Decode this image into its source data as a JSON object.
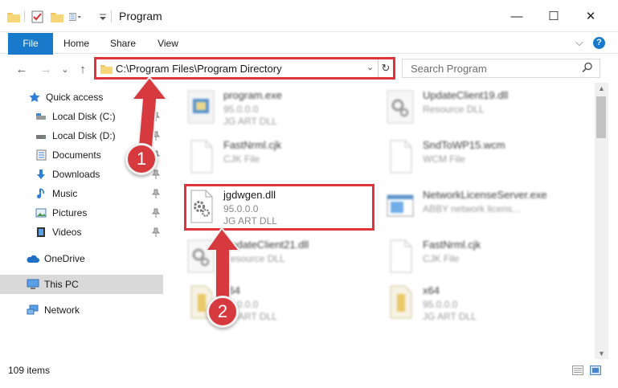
{
  "window": {
    "title": "Program",
    "minimize_label": "—",
    "maximize_label": "☐",
    "close_label": "✕"
  },
  "ribbon": {
    "tabs": [
      {
        "label": "File"
      },
      {
        "label": "Home"
      },
      {
        "label": "Share"
      },
      {
        "label": "View"
      }
    ],
    "collapse_label": "⌵",
    "help_label": "?"
  },
  "address": {
    "path": "C:\\Program Files\\Program Directory",
    "dropdown_label": "⌄",
    "refresh_label": "↻"
  },
  "search": {
    "placeholder": "Search Program"
  },
  "nav": {
    "back_label": "←",
    "forward_label": "→",
    "recent_label": "⌄",
    "up_label": "↑",
    "items": [
      {
        "label": "Quick access",
        "icon": "star-icon",
        "pinned": false
      },
      {
        "label": "Local Disk (C:)",
        "icon": "drive-icon",
        "pinned": true
      },
      {
        "label": "Local Disk (D:)",
        "icon": "drive-icon",
        "pinned": true
      },
      {
        "label": "Documents",
        "icon": "documents-icon",
        "pinned": true
      },
      {
        "label": "Downloads",
        "icon": "download-icon",
        "pinned": true
      },
      {
        "label": "Music",
        "icon": "music-icon",
        "pinned": true
      },
      {
        "label": "Pictures",
        "icon": "pictures-icon",
        "pinned": true
      },
      {
        "label": "Videos",
        "icon": "videos-icon",
        "pinned": true
      },
      {
        "label": "OneDrive",
        "icon": "cloud-icon",
        "pinned": false
      },
      {
        "label": "This PC",
        "icon": "computer-icon",
        "pinned": false,
        "selected": true
      },
      {
        "label": "Network",
        "icon": "network-icon",
        "pinned": false
      }
    ]
  },
  "files": [
    {
      "name": "program.exe",
      "line2": "95.0.0.0",
      "line3": "JG ART DLL",
      "icon": "exe-icon"
    },
    {
      "name": "UpdateClient19.dll",
      "line2": "Resource DLL",
      "line3": "",
      "icon": "dll-icon"
    },
    {
      "name": "FastNrml.cjk",
      "line2": "CJK File",
      "line3": "",
      "icon": "blank-file-icon"
    },
    {
      "name": "SndToWP15.wcm",
      "line2": "WCM File",
      "line3": "",
      "icon": "blank-file-icon"
    },
    {
      "name": "jgdwgen.dll",
      "line2": "95.0.0.0",
      "line3": "JG ART DLL",
      "icon": "dll-icon"
    },
    {
      "name": "NetworkLicenseServer.exe",
      "line2": "ABBY network licens...",
      "line3": "",
      "icon": "app-window-icon"
    },
    {
      "name": "UpdateClient21.dll",
      "line2": "Resource DLL",
      "line3": "",
      "icon": "dll-icon"
    },
    {
      "name": "FastNrml.cjk",
      "line2": "CJK File",
      "line3": "",
      "icon": "blank-file-icon"
    },
    {
      "name": "x64",
      "line2": "95.0.0.0",
      "line3": "JG ART DLL",
      "icon": "folder-file-icon"
    },
    {
      "name": "x64",
      "line2": "95.0.0.0",
      "line3": "JG ART DLL",
      "icon": "folder-file-icon"
    }
  ],
  "status": {
    "items_count": "109 items"
  },
  "callouts": [
    {
      "label": "1"
    },
    {
      "label": "2"
    }
  ],
  "colors": {
    "accent": "#1979ca",
    "highlight": "#e0343d",
    "callout": "#d63a3e",
    "selected_nav": "#d9d9d9"
  }
}
